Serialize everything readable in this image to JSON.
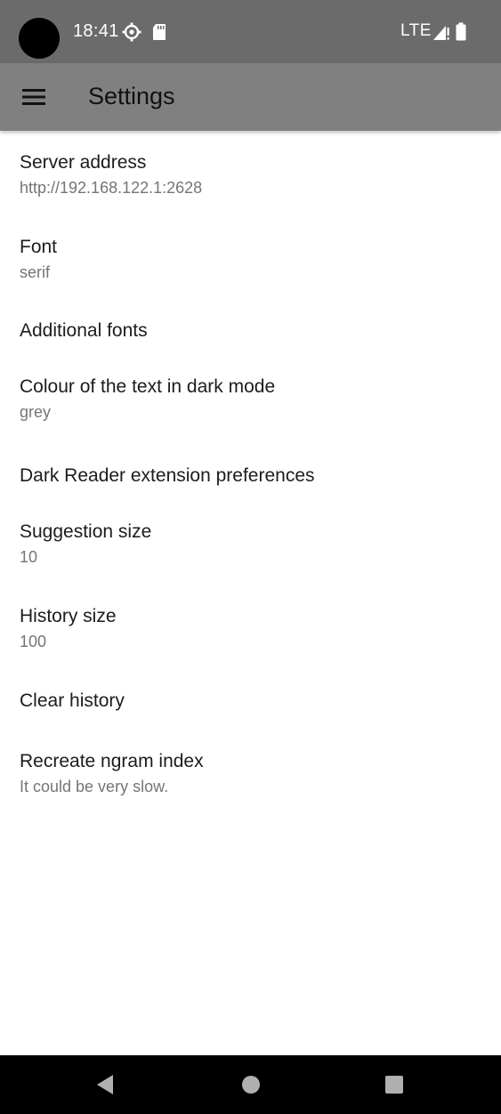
{
  "status_bar": {
    "time": "18:41",
    "network": "LTE",
    "icons": [
      "settings-gear-icon",
      "sd-card-icon",
      "signal-icon",
      "battery-icon"
    ]
  },
  "app_bar": {
    "title": "Settings",
    "menu_icon": "hamburger-menu-icon"
  },
  "settings": {
    "items": [
      {
        "title": "Server address",
        "summary": "http://192.168.122.1:2628"
      },
      {
        "title": "Font",
        "summary": "serif"
      },
      {
        "title": "Additional fonts",
        "summary": ""
      },
      {
        "title": "Colour of the text in dark mode",
        "summary": "grey"
      },
      {
        "title": "Dark Reader extension preferences",
        "summary": ""
      },
      {
        "title": "Suggestion size",
        "summary": "10"
      },
      {
        "title": "History size",
        "summary": "100"
      },
      {
        "title": "Clear history",
        "summary": ""
      },
      {
        "title": "Recreate ngram index",
        "summary": "It could be very slow."
      }
    ]
  },
  "nav_bar": {
    "buttons": [
      "back-icon",
      "home-icon",
      "recents-icon"
    ]
  },
  "colors": {
    "status_bar": "#6b6b6b",
    "app_bar": "#808080",
    "title_text": "#1c1c1c",
    "summary_text": "#757575",
    "nav_bar": "#000000"
  }
}
